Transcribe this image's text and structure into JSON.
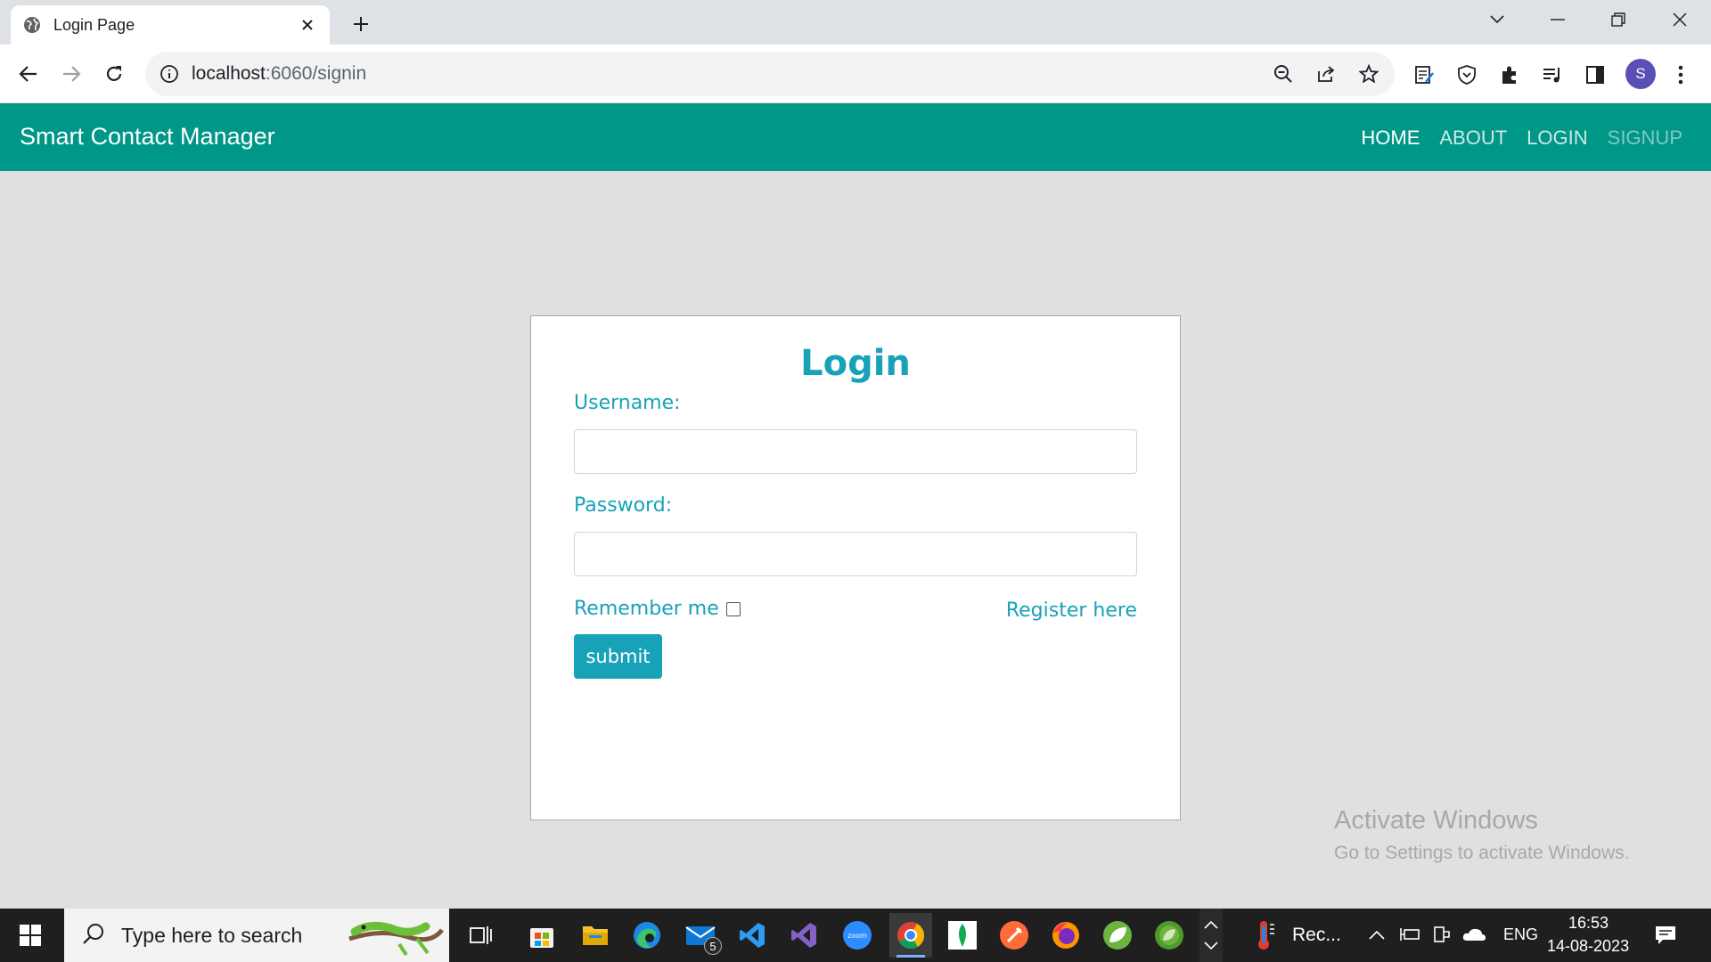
{
  "browser": {
    "tab_title": "Login Page",
    "url_host": "localhost",
    "url_rest": ":6060/signin",
    "profile_initial": "S"
  },
  "navbar": {
    "brand": "Smart Contact Manager",
    "links": [
      {
        "label": "HOME",
        "color": "#ffffff"
      },
      {
        "label": "ABOUT",
        "color": "#cce9e6"
      },
      {
        "label": "LOGIN",
        "color": "#cce9e6"
      },
      {
        "label": "SIGNUP",
        "color": "#7fcac3"
      }
    ]
  },
  "form": {
    "title": "Login",
    "username_label": "Username:",
    "username_value": "",
    "password_label": "Password:",
    "password_value": "",
    "remember_label": "Remember me",
    "remember_checked": false,
    "register_link": "Register here",
    "submit_label": "submit"
  },
  "watermark": {
    "line1": "Activate Windows",
    "line2": "Go to Settings to activate Windows."
  },
  "taskbar": {
    "search_placeholder": "Type here to search",
    "mail_badge": "5",
    "running_app_label": "Rec...",
    "language": "ENG",
    "time": "16:53",
    "date": "14-08-2023"
  },
  "colors": {
    "appbar": "#009688",
    "accent": "#17a2b8",
    "page_bg": "#e0e0e0"
  }
}
